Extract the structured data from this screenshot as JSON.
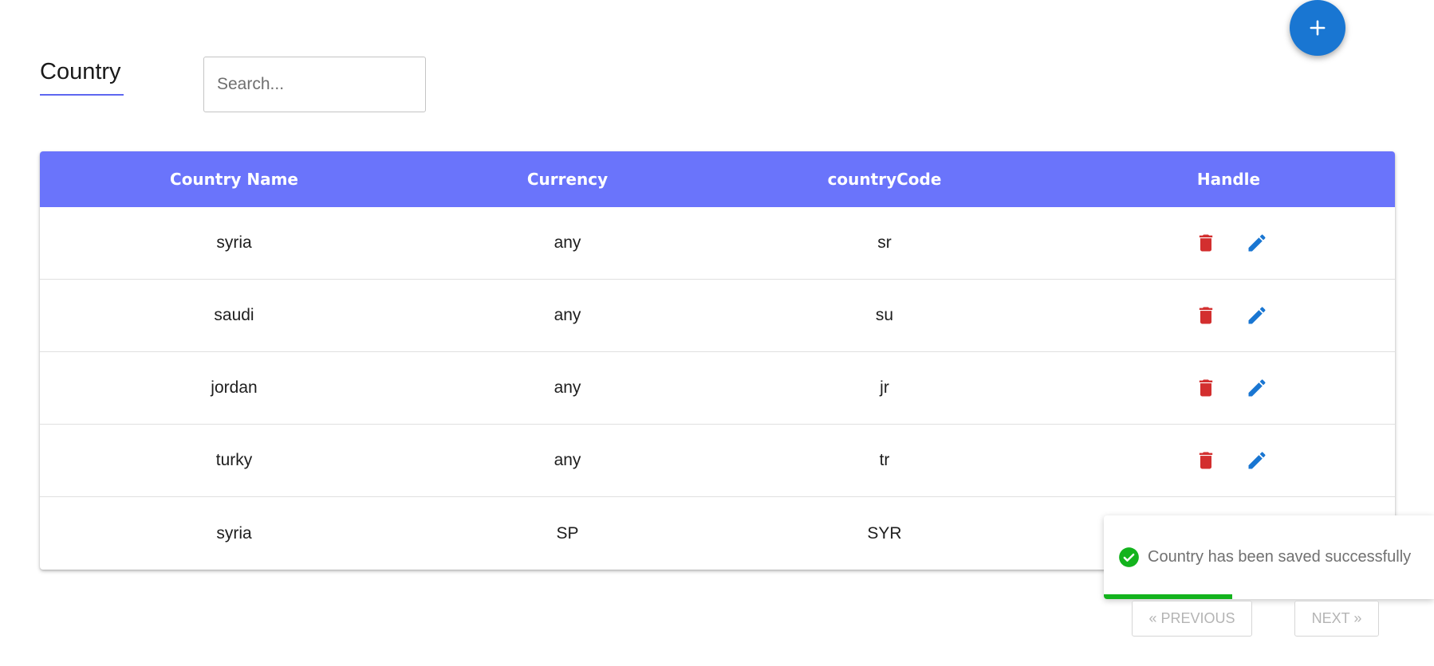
{
  "header": {
    "title": "Country",
    "search_placeholder": "Search...",
    "add_button_label": "+"
  },
  "table": {
    "columns": [
      "Country Name",
      "Currency",
      "countryCode",
      "Handle"
    ],
    "rows": [
      {
        "name": "syria",
        "currency": "any",
        "code": "sr",
        "has_actions": true
      },
      {
        "name": "saudi",
        "currency": "any",
        "code": "su",
        "has_actions": true
      },
      {
        "name": "jordan",
        "currency": "any",
        "code": "jr",
        "has_actions": true
      },
      {
        "name": "turky",
        "currency": "any",
        "code": "tr",
        "has_actions": true
      },
      {
        "name": "syria",
        "currency": "SP",
        "code": "SYR",
        "has_actions": true
      }
    ],
    "action_icons": [
      "trash-icon",
      "pencil-icon"
    ]
  },
  "toast": {
    "message": "Country has been saved successfully",
    "icon": "check-circle-icon",
    "progress_percent": 39,
    "status_color": "#13b31d"
  },
  "pagination": {
    "previous_label": "« PREVIOUS",
    "next_label": "NEXT »"
  },
  "colors": {
    "header_bg": "#6a74fb",
    "accent": "#1976d2",
    "delete": "#d32f2f",
    "edit": "#1976d2",
    "underline": "#5e67f0"
  }
}
